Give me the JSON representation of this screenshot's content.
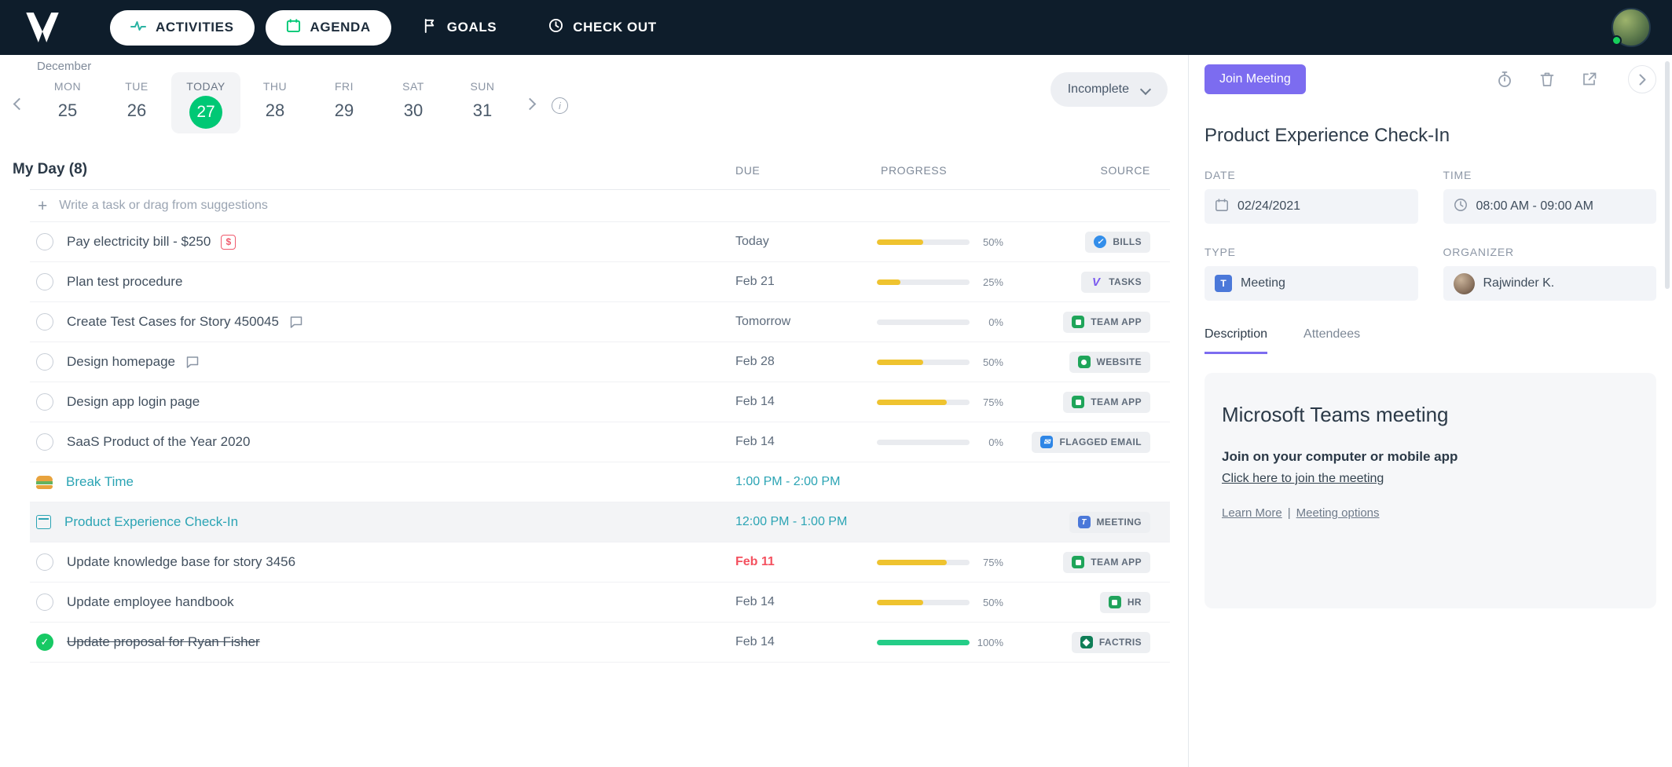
{
  "colors": {
    "topbar_bg": "#0E1D2B",
    "accent_purple": "#7C6CF0",
    "brand_green": "#00C875",
    "teal_link": "#2BA4B4",
    "progress_yellow": "#EFC32F",
    "progress_green": "#24CD87",
    "overdue_red": "#F4515F"
  },
  "topbar": {
    "nav": [
      {
        "label": "ACTIVITIES",
        "icon": "activity-icon"
      },
      {
        "label": "AGENDA",
        "icon": "agenda-calendar-icon"
      },
      {
        "label": "GOALS",
        "icon": "goals-flag-icon"
      },
      {
        "label": "CHECK OUT",
        "icon": "checkout-clock-icon"
      }
    ]
  },
  "calendar": {
    "month": "December",
    "days": [
      {
        "dow": "MON",
        "date": "25"
      },
      {
        "dow": "TUE",
        "date": "26"
      },
      {
        "dow": "TODAY",
        "date": "27"
      },
      {
        "dow": "THU",
        "date": "28"
      },
      {
        "dow": "FRI",
        "date": "29"
      },
      {
        "dow": "SAT",
        "date": "30"
      },
      {
        "dow": "SUN",
        "date": "31"
      }
    ],
    "filter_label": "Incomplete"
  },
  "list": {
    "title": "My Day (8)",
    "columns": {
      "due": "DUE",
      "progress": "PROGRESS",
      "source": "SOURCE"
    },
    "add_placeholder": "Write a task or drag from suggestions",
    "rows": [
      {
        "title": "Pay electricity bill - $250",
        "icon": "money-icon",
        "due": "Today",
        "progress": 50,
        "progress_text": "50%",
        "source": {
          "label": "BILLS",
          "icon": "check-circle-icon"
        }
      },
      {
        "title": "Plan test procedure",
        "due": "Feb 21",
        "progress": 25,
        "progress_text": "25%",
        "source": {
          "label": "TASKS",
          "icon": "v-logo-icon"
        }
      },
      {
        "title": "Create Test Cases for Story 450045",
        "icon": "comment-icon",
        "due": "Tomorrow",
        "progress": 0,
        "progress_text": "0%",
        "source": {
          "label": "TEAM APP",
          "icon": "team-app-icon"
        }
      },
      {
        "title": "Design homepage",
        "icon": "comment-icon",
        "due": "Feb 28",
        "progress": 50,
        "progress_text": "50%",
        "source": {
          "label": "WEBSITE",
          "icon": "website-icon"
        }
      },
      {
        "title": "Design app login page",
        "due": "Feb 14",
        "progress": 75,
        "progress_text": "75%",
        "source": {
          "label": "TEAM APP",
          "icon": "team-app-icon"
        }
      },
      {
        "title": "SaaS Product of the Year 2020",
        "due": "Feb 14",
        "progress": 0,
        "progress_text": "0%",
        "source": {
          "label": "FLAGGED EMAIL",
          "icon": "email-icon"
        }
      },
      {
        "title": "Break Time",
        "icon": "burger-icon",
        "due": "1:00 PM - 2:00 PM"
      },
      {
        "title": "Product Experience Check-In",
        "icon": "calendar-icon",
        "due": "12:00 PM - 1:00 PM",
        "selected": true,
        "source": {
          "label": "MEETING",
          "icon": "teams-icon"
        }
      },
      {
        "title": "Update knowledge base for story 3456",
        "due": "Feb 11",
        "overdue": true,
        "progress": 75,
        "progress_text": "75%",
        "source": {
          "label": "TEAM APP",
          "icon": "team-app-icon"
        }
      },
      {
        "title": "Update employee handbook",
        "due": "Feb 14",
        "progress": 50,
        "progress_text": "50%",
        "source": {
          "label": "HR",
          "icon": "hr-icon"
        }
      },
      {
        "title": "Update proposal for Ryan Fisher",
        "completed": true,
        "due": "Feb 14",
        "progress": 100,
        "progress_text": "100%",
        "source": {
          "label": "FACTRIS",
          "icon": "factris-icon"
        }
      }
    ]
  },
  "detail": {
    "join_button": "Join Meeting",
    "title": "Product Experience Check-In",
    "date": {
      "label": "DATE",
      "value": "02/24/2021"
    },
    "time": {
      "label": "TIME",
      "value": "08:00 AM - 09:00 AM"
    },
    "type": {
      "label": "TYPE",
      "value": "Meeting"
    },
    "organizer": {
      "label": "ORGANIZER",
      "value": "Rajwinder K."
    },
    "tabs": [
      {
        "label": "Description"
      },
      {
        "label": "Attendees"
      }
    ],
    "description": {
      "heading": "Microsoft Teams meeting",
      "subheading": "Join on your computer or mobile app",
      "join_link": "Click here to join the meeting",
      "learn_more": "Learn More",
      "separator": "|",
      "meeting_options": "Meeting options"
    }
  }
}
